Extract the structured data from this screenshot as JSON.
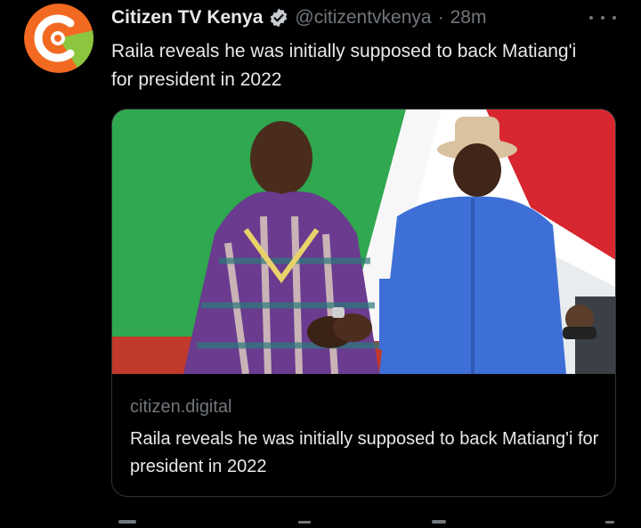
{
  "tweet": {
    "display_name": "Citizen TV Kenya",
    "handle": "@citizentvkenya",
    "separator": "·",
    "time": "28m",
    "text": "Raila reveals he was initially supposed to back Matiang'i for president in 2022"
  },
  "card": {
    "domain": "citizen.digital",
    "title": "Raila reveals he was initially supposed to back Matiang'i for president in 2022"
  },
  "icons": {
    "verified": "verified-badge-icon",
    "more": "more-options-icon"
  },
  "colors": {
    "background": "#000000",
    "text_primary": "#e7e9ea",
    "text_secondary": "#71767b",
    "card_border": "#2f3336",
    "avatar_orange": "#f26a21",
    "avatar_green": "#8cc63f"
  }
}
